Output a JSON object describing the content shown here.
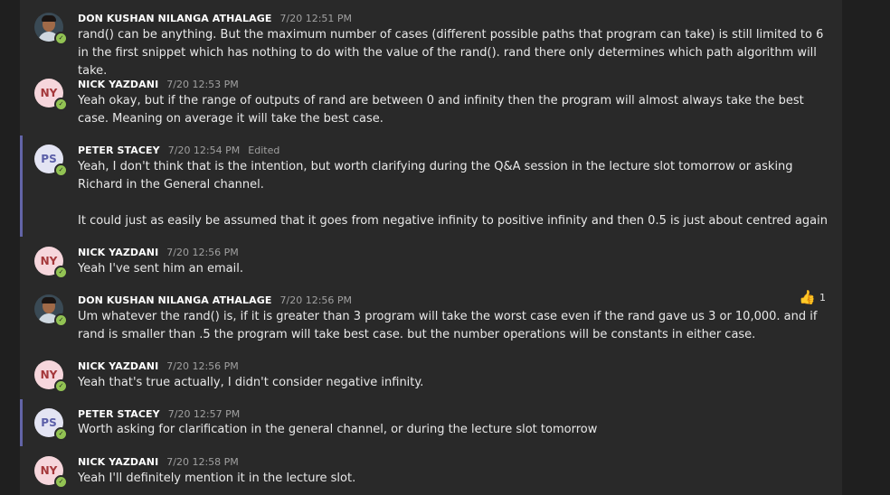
{
  "messages": [
    {
      "author": "DON KUSHAN NILANGA ATHALAGE",
      "time": "7/20 12:51 PM",
      "avatar_initials": "",
      "body": [
        "rand() can be anything. But the maximum number of cases (different possible paths that program can take) is still limited to 6 in the first snippet which has nothing to do with the value of the rand(). rand there only determines which path algorithm will take."
      ]
    },
    {
      "author": "NICK YAZDANI",
      "time": "7/20 12:53 PM",
      "avatar_initials": "NY",
      "body": [
        "Yeah okay, but if the range of outputs of rand are between 0 and infinity then the program will almost always take the best case. Meaning on average it will take the best case."
      ]
    },
    {
      "author": "PETER STACEY",
      "time": "7/20 12:54 PM",
      "edited": "Edited",
      "avatar_initials": "PS",
      "body": [
        "Yeah, I don't think that is the intention, but worth clarifying during the Q&A session in the lecture slot tomorrow or asking Richard in the General channel.",
        "It could just as easily be assumed that it goes from negative infinity to positive infinity and then 0.5 is just about centred again"
      ]
    },
    {
      "author": "NICK YAZDANI",
      "time": "7/20 12:56 PM",
      "avatar_initials": "NY",
      "body": [
        "Yeah I've sent him an email."
      ]
    },
    {
      "author": "DON KUSHAN NILANGA ATHALAGE",
      "time": "7/20 12:56 PM",
      "avatar_initials": "",
      "reaction": {
        "icon": "thumbs-up-icon",
        "count": "1"
      },
      "body": [
        "Um whatever the rand() is, if it is greater than 3 program will take the worst case even if the rand gave us 3 or 10,000. and if rand is smaller than .5 the program will take best case. but the number operations will be constants in either case."
      ]
    },
    {
      "author": "NICK YAZDANI",
      "time": "7/20 12:56 PM",
      "avatar_initials": "NY",
      "body": [
        "Yeah that's true actually, I didn't consider negative infinity."
      ]
    },
    {
      "author": "PETER STACEY",
      "time": "7/20 12:57 PM",
      "avatar_initials": "PS",
      "body": [
        "Worth asking for clarification in the general channel, or during the lecture slot tomorrow"
      ]
    },
    {
      "author": "NICK YAZDANI",
      "time": "7/20 12:58 PM",
      "avatar_initials": "NY",
      "body": [
        "Yeah I'll definitely mention it in the lecture slot."
      ]
    }
  ],
  "colors": {
    "background": "#1f1f1f",
    "panel": "#292929",
    "own_message_bar": "#6264a7",
    "presence_available": "#92c353"
  }
}
